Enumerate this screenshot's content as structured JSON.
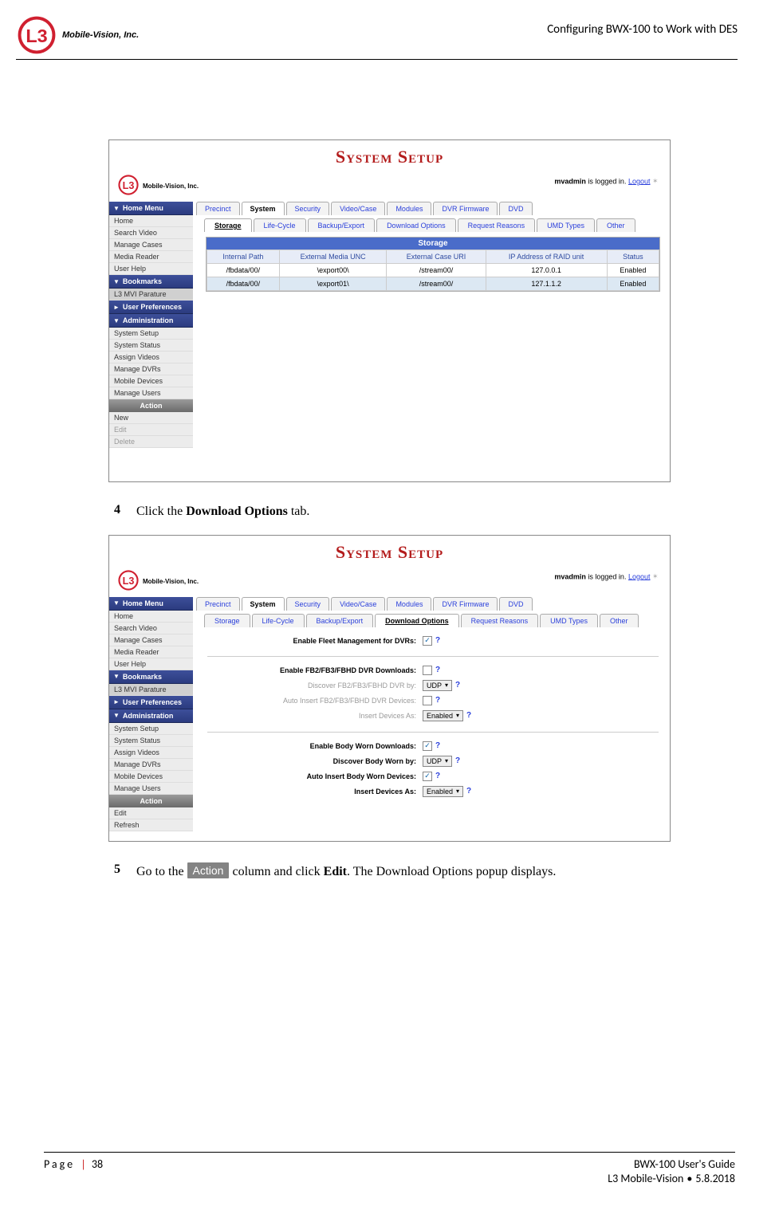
{
  "doc_header": {
    "company": "Mobile-Vision, Inc.",
    "title": "Configuring BWX-100 to Work with DES"
  },
  "steps": {
    "s4": {
      "num": "4",
      "prefix": "Click the ",
      "bold": "Download Options",
      "suffix": " tab."
    },
    "s5": {
      "num": "5",
      "prefix": "Go to the ",
      "chip": "Action",
      "mid": " column and click ",
      "bold": "Edit",
      "suffix": ". The Download Options popup displays."
    }
  },
  "shot": {
    "title": "System Setup",
    "company": "Mobile-Vision, Inc.",
    "login_user": "mvadmin",
    "login_text": " is logged in.  ",
    "logout": "Logout",
    "sidebar": {
      "home_menu": "Home Menu",
      "home_items": [
        "Home",
        "Search Video",
        "Manage Cases",
        "Media Reader",
        "User Help"
      ],
      "bookmarks": "Bookmarks",
      "bookmarks_items": [
        "L3 MVI Parature"
      ],
      "user_prefs": "User Preferences",
      "admin": "Administration",
      "admin_items": [
        "System Setup",
        "System Status",
        "Assign Videos",
        "Manage DVRs",
        "Mobile Devices",
        "Manage Users"
      ],
      "action": "Action",
      "action_items1": [
        "New",
        "Edit",
        "Delete"
      ],
      "action_items2": [
        "Edit",
        "Refresh"
      ]
    },
    "tabs1": [
      "Precinct",
      "System",
      "Security",
      "Video/Case",
      "Modules",
      "DVR Firmware",
      "DVD"
    ],
    "tabs2": [
      "Storage",
      "Life-Cycle",
      "Backup/Export",
      "Download Options",
      "Request Reasons",
      "UMD Types",
      "Other"
    ],
    "storage": {
      "title": "Storage",
      "headers": [
        "Internal Path",
        "External Media UNC",
        "External Case URI",
        "IP Address of RAID unit",
        "Status"
      ],
      "rows": [
        [
          "/fbdata/00/",
          "\\export00\\",
          "/stream00/",
          "127.0.0.1",
          "Enabled"
        ],
        [
          "/fbdata/00/",
          "\\export01\\",
          "/stream00/",
          "127.1.1.2",
          "Enabled"
        ]
      ]
    },
    "form": {
      "fleet": "Enable Fleet Management for DVRs:",
      "fb2dl": "Enable FB2/FB3/FBHD DVR Downloads:",
      "fb2disc": "Discover FB2/FB3/FBHD DVR by:",
      "fb2auto": "Auto Insert FB2/FB3/FBHD DVR Devices:",
      "fb2ins": "Insert Devices As:",
      "bwdl": "Enable Body Worn Downloads:",
      "bwdisc": "Discover Body Worn by:",
      "bwauto": "Auto Insert Body Worn Devices:",
      "bwins": "Insert Devices As:",
      "udp": "UDP",
      "enabled": "Enabled"
    }
  },
  "footer": {
    "page_label": "Page",
    "page_num": "38",
    "guide": "BWX-100 User's Guide",
    "vendor": "L3 Mobile-Vision",
    "date": "5.8.2018"
  }
}
